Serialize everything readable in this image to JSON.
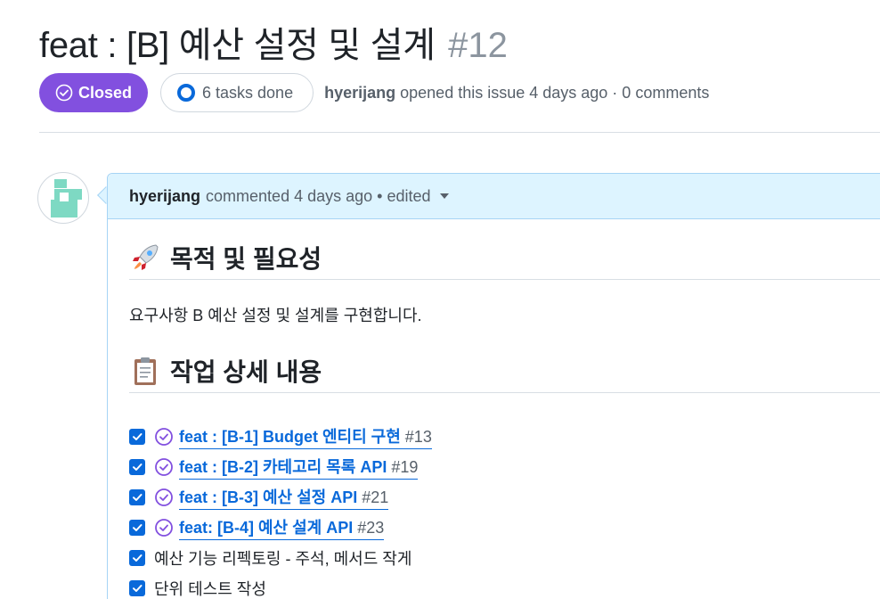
{
  "issue": {
    "title": "feat : [B] 예산 설정 및 설계",
    "number": "#12",
    "state": "Closed",
    "tasks_summary": "6 tasks done",
    "author": "hyerijang",
    "opened_text": "opened this issue 4 days ago · 0 comments"
  },
  "comment": {
    "author": "hyerijang",
    "meta": "commented 4 days ago • edited",
    "sections": [
      {
        "emoji": "rocket-emoji",
        "heading": "목적 및 필요성"
      },
      {
        "emoji": "clipboard-emoji",
        "heading": "작업 상세 내용"
      }
    ],
    "purpose_text": "요구사항 B 예산 설정 및 설계를 구현합니다.",
    "tasks": [
      {
        "checked": true,
        "title": "feat : [B-1] Budget 엔티티 구현",
        "ref": "#13"
      },
      {
        "checked": true,
        "title": "feat : [B-2] 카테고리 목록 API",
        "ref": "#19"
      },
      {
        "checked": true,
        "title": "feat : [B-3] 예산 설정 API",
        "ref": "#21"
      },
      {
        "checked": true,
        "title": "feat: [B-4] 예산 설계 API",
        "ref": "#23"
      },
      {
        "checked": true,
        "text": "예산 기능 리펙토링 - 주석, 메서드 작게"
      },
      {
        "checked": true,
        "text": "단위 테스트 작성"
      }
    ]
  },
  "colors": {
    "closed_purple": "#8250df",
    "link_blue": "#0969da",
    "header_bg": "#ddf4ff"
  }
}
